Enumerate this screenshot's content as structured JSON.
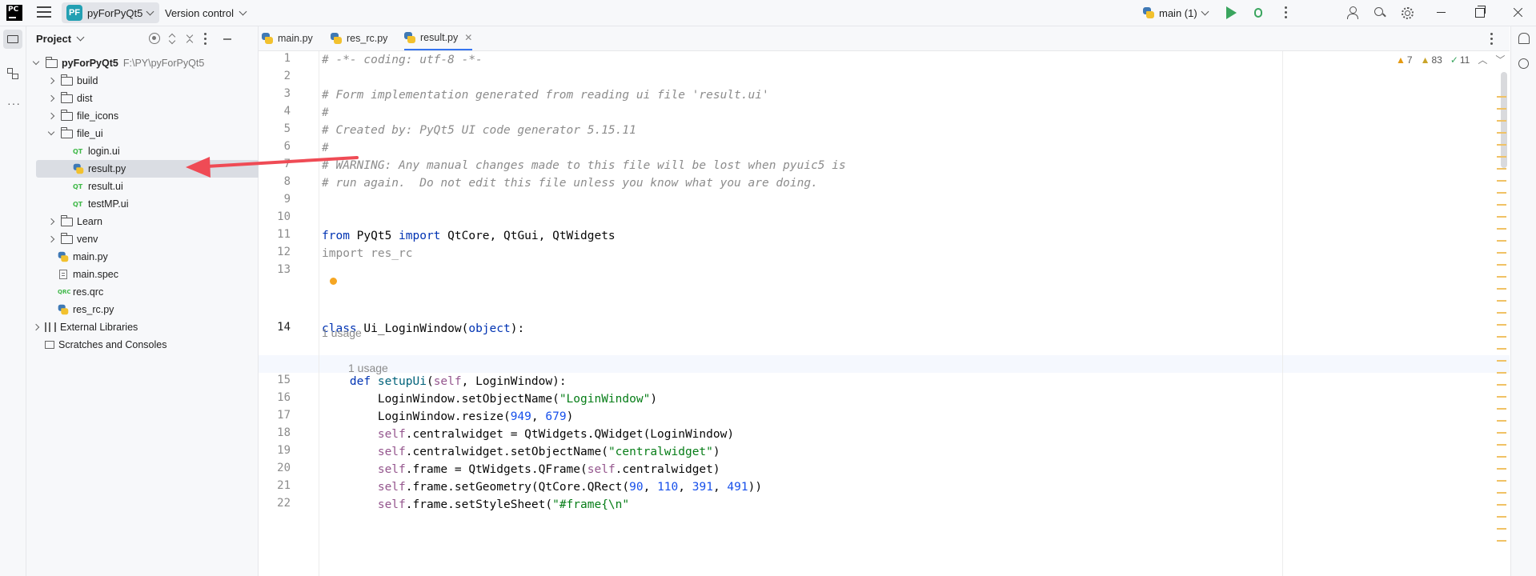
{
  "titlebar": {
    "app_logo": "PC",
    "project_badge": "PF",
    "project_name": "pyForPyQt5",
    "version_control": "Version control",
    "branch": "main (1)",
    "icons": [
      "hamburger-icon",
      "run-icon",
      "debug-icon",
      "more-icon",
      "add-user-icon",
      "search-icon",
      "gear-icon",
      "minimize-icon",
      "maximize-icon",
      "close-icon"
    ]
  },
  "project_panel": {
    "title": "Project",
    "tree": [
      {
        "label": "pyForPyQt5",
        "hint": "F:\\PY\\pyForPyQt5",
        "type": "folder",
        "depth": 0,
        "expanded": true,
        "bold": true
      },
      {
        "label": "build",
        "type": "folder",
        "depth": 1,
        "expanded": false
      },
      {
        "label": "dist",
        "type": "folder",
        "depth": 1,
        "expanded": false
      },
      {
        "label": "file_icons",
        "type": "folder",
        "depth": 1,
        "expanded": false
      },
      {
        "label": "file_ui",
        "type": "folder",
        "depth": 1,
        "expanded": true
      },
      {
        "label": "login.ui",
        "type": "qt",
        "depth": 2
      },
      {
        "label": "result.py",
        "type": "py",
        "depth": 2,
        "selected": true
      },
      {
        "label": "result.ui",
        "type": "qt",
        "depth": 2
      },
      {
        "label": "testMP.ui",
        "type": "qt",
        "depth": 2
      },
      {
        "label": "Learn",
        "type": "folder",
        "depth": 1,
        "expanded": false
      },
      {
        "label": "venv",
        "type": "folder",
        "depth": 1,
        "expanded": false
      },
      {
        "label": "main.py",
        "type": "py",
        "depth": 1
      },
      {
        "label": "main.spec",
        "type": "spec",
        "depth": 1
      },
      {
        "label": "res.qrc",
        "type": "qrc",
        "depth": 1
      },
      {
        "label": "res_rc.py",
        "type": "py",
        "depth": 1
      },
      {
        "label": "External Libraries",
        "type": "lib",
        "depth": 0,
        "expanded": false
      },
      {
        "label": "Scratches and Consoles",
        "type": "scratch",
        "depth": 0
      }
    ]
  },
  "tabs": [
    {
      "label": "main.py",
      "active": false
    },
    {
      "label": "res_rc.py",
      "active": false
    },
    {
      "label": "result.py",
      "active": true
    }
  ],
  "inspections": {
    "warnings": "7",
    "weak_warnings": "83",
    "ok": "11"
  },
  "editor": {
    "current_line": "14",
    "usage_hints": [
      "1 usage",
      "1 usage"
    ],
    "lines": [
      {
        "n": "1",
        "tokens": [
          {
            "c": "cm",
            "t": "# -*- coding: utf-8 -*-"
          }
        ]
      },
      {
        "n": "2",
        "tokens": []
      },
      {
        "n": "3",
        "tokens": [
          {
            "c": "cm",
            "t": "# Form implementation generated from reading ui file 'result.ui'"
          }
        ]
      },
      {
        "n": "4",
        "tokens": [
          {
            "c": "cm",
            "t": "#"
          }
        ]
      },
      {
        "n": "5",
        "tokens": [
          {
            "c": "cm",
            "t": "# Created by: PyQt5 UI code generator 5.15.11"
          }
        ]
      },
      {
        "n": "6",
        "tokens": [
          {
            "c": "cm",
            "t": "#"
          }
        ]
      },
      {
        "n": "7",
        "tokens": [
          {
            "c": "cm",
            "t": "# WARNING: Any manual changes made to this file will be lost when pyuic5 is"
          }
        ]
      },
      {
        "n": "8",
        "tokens": [
          {
            "c": "cm",
            "t": "# run again.  Do not edit this file unless you know what you are doing."
          }
        ]
      },
      {
        "n": "9",
        "tokens": []
      },
      {
        "n": "10",
        "tokens": []
      },
      {
        "n": "11",
        "tokens": [
          {
            "c": "kw",
            "t": "from"
          },
          {
            "c": "",
            "t": " PyQt5 "
          },
          {
            "c": "kw",
            "t": "import"
          },
          {
            "c": "",
            "t": " QtCore, QtGui, QtWidgets"
          }
        ]
      },
      {
        "n": "12",
        "tokens": [
          {
            "c": "cm0",
            "t": "import res_rc"
          }
        ]
      },
      {
        "n": "13",
        "tokens": []
      },
      {
        "n": "14",
        "tokens": [
          {
            "c": "kw",
            "t": "class"
          },
          {
            "c": "",
            "t": " Ui_LoginWindow("
          },
          {
            "c": "kw",
            "t": "object"
          },
          {
            "c": "",
            "t": "):"
          }
        ]
      },
      {
        "n": "15",
        "tokens": [
          {
            "c": "",
            "t": "    "
          },
          {
            "c": "kw",
            "t": "def"
          },
          {
            "c": "",
            "t": " "
          },
          {
            "c": "fn",
            "t": "setupUi"
          },
          {
            "c": "",
            "t": "("
          },
          {
            "c": "sf",
            "t": "self"
          },
          {
            "c": "",
            "t": ", LoginWindow):"
          }
        ]
      },
      {
        "n": "16",
        "tokens": [
          {
            "c": "",
            "t": "        LoginWindow.setObjectName("
          },
          {
            "c": "st",
            "t": "\"LoginWindow\""
          },
          {
            "c": "",
            "t": ")"
          }
        ]
      },
      {
        "n": "17",
        "tokens": [
          {
            "c": "",
            "t": "        LoginWindow.resize("
          },
          {
            "c": "nu",
            "t": "949"
          },
          {
            "c": "",
            "t": ", "
          },
          {
            "c": "nu",
            "t": "679"
          },
          {
            "c": "",
            "t": ")"
          }
        ]
      },
      {
        "n": "18",
        "tokens": [
          {
            "c": "",
            "t": "        "
          },
          {
            "c": "sf",
            "t": "self"
          },
          {
            "c": "",
            "t": ".centralwidget = QtWidgets.QWidget(LoginWindow)"
          }
        ]
      },
      {
        "n": "19",
        "tokens": [
          {
            "c": "",
            "t": "        "
          },
          {
            "c": "sf",
            "t": "self"
          },
          {
            "c": "",
            "t": ".centralwidget.setObjectName("
          },
          {
            "c": "st",
            "t": "\"centralwidget\""
          },
          {
            "c": "",
            "t": ")"
          }
        ]
      },
      {
        "n": "20",
        "tokens": [
          {
            "c": "",
            "t": "        "
          },
          {
            "c": "sf",
            "t": "self"
          },
          {
            "c": "",
            "t": ".frame = QtWidgets.QFrame("
          },
          {
            "c": "sf",
            "t": "self"
          },
          {
            "c": "",
            "t": ".centralwidget)"
          }
        ]
      },
      {
        "n": "21",
        "tokens": [
          {
            "c": "",
            "t": "        "
          },
          {
            "c": "sf",
            "t": "self"
          },
          {
            "c": "",
            "t": ".frame.setGeometry(QtCore.QRect("
          },
          {
            "c": "nu",
            "t": "90"
          },
          {
            "c": "",
            "t": ", "
          },
          {
            "c": "nu",
            "t": "110"
          },
          {
            "c": "",
            "t": ", "
          },
          {
            "c": "nu",
            "t": "391"
          },
          {
            "c": "",
            "t": ", "
          },
          {
            "c": "nu",
            "t": "491"
          },
          {
            "c": "",
            "t": "))"
          }
        ]
      },
      {
        "n": "22",
        "tokens": [
          {
            "c": "",
            "t": "        "
          },
          {
            "c": "sf",
            "t": "self"
          },
          {
            "c": "",
            "t": ".frame.setStyleSheet("
          },
          {
            "c": "st",
            "t": "\"#frame{\\n\""
          }
        ]
      }
    ]
  },
  "colors": {
    "accent": "#3574f0",
    "annotation_arrow": "#ef4b55",
    "run_green": "#3aa55e"
  }
}
